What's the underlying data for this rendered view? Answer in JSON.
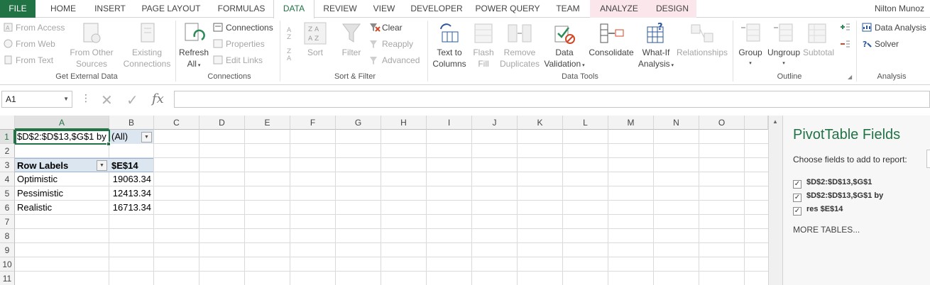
{
  "tabs": [
    {
      "label": "FILE"
    },
    {
      "label": "HOME"
    },
    {
      "label": "INSERT"
    },
    {
      "label": "PAGE LAYOUT"
    },
    {
      "label": "FORMULAS"
    },
    {
      "label": "DATA"
    },
    {
      "label": "REVIEW"
    },
    {
      "label": "VIEW"
    },
    {
      "label": "DEVELOPER"
    },
    {
      "label": "POWER QUERY"
    },
    {
      "label": "TEAM"
    },
    {
      "label": "ANALYZE"
    },
    {
      "label": "DESIGN"
    }
  ],
  "active_tab": "DATA",
  "user_name": "Nilton Munoz",
  "ribbon": {
    "get_external": {
      "from_access": "From Access",
      "from_web": "From Web",
      "from_text": "From Text",
      "from_other_1": "From Other",
      "from_other_2": "Sources",
      "existing_1": "Existing",
      "existing_2": "Connections",
      "label": "Get External Data"
    },
    "connections": {
      "refresh_1": "Refresh",
      "refresh_2": "All",
      "connections": "Connections",
      "properties": "Properties",
      "edit_links": "Edit Links",
      "label": "Connections"
    },
    "sort_filter": {
      "sort": "Sort",
      "filter": "Filter",
      "clear": "Clear",
      "reapply": "Reapply",
      "advanced": "Advanced",
      "label": "Sort & Filter"
    },
    "data_tools": {
      "text_to_1": "Text to",
      "text_to_2": "Columns",
      "flash_1": "Flash",
      "flash_2": "Fill",
      "remove_1": "Remove",
      "remove_2": "Duplicates",
      "validation_1": "Data",
      "validation_2": "Validation",
      "consolidate": "Consolidate",
      "whatif_1": "What-If",
      "whatif_2": "Analysis",
      "relationships": "Relationships",
      "label": "Data Tools"
    },
    "outline": {
      "group": "Group",
      "ungroup": "Ungroup",
      "subtotal": "Subtotal",
      "label": "Outline"
    },
    "analysis": {
      "data_analysis": "Data Analysis",
      "solver": "Solver",
      "label": "Analysis"
    }
  },
  "formula_bar": {
    "name_box": "A1",
    "cancel_glyph": "✕",
    "enter_glyph": "✓",
    "fx": "fx",
    "formula": ""
  },
  "sheet": {
    "columns": [
      "A",
      "B",
      "C",
      "D",
      "E",
      "F",
      "G",
      "H",
      "I",
      "J",
      "K",
      "L",
      "M",
      "N",
      "O"
    ],
    "rows": [
      "1",
      "2",
      "3",
      "4",
      "5",
      "6",
      "7",
      "8",
      "9",
      "10",
      "11"
    ],
    "selected_cell": "A1",
    "filter_label": "$D$2:$D$13,$G$1 by",
    "filter_value": "(All)",
    "pivot_header_left": "Row Labels",
    "pivot_header_right": "$E$14",
    "pivot_rows": [
      {
        "label": "Optimistic",
        "value": "19063.34"
      },
      {
        "label": "Pessimistic",
        "value": "12413.34"
      },
      {
        "label": "Realistic",
        "value": "16713.34"
      }
    ]
  },
  "pivot_pane": {
    "title": "PivotTable Fields",
    "subtitle": "Choose fields to add to report:",
    "fields": [
      {
        "label": "$D$2:$D$13,$G$1",
        "checked": true
      },
      {
        "label": "$D$2:$D$13,$G$1 by",
        "checked": true
      },
      {
        "label": "res $E$14",
        "checked": true
      }
    ],
    "check_glyph": "✓",
    "more_tables": "MORE TABLES..."
  },
  "colors": {
    "excel_green": "#217346",
    "context_tab_bg": "#fbe6ec",
    "pivot_header_bg": "#dce6f1"
  }
}
